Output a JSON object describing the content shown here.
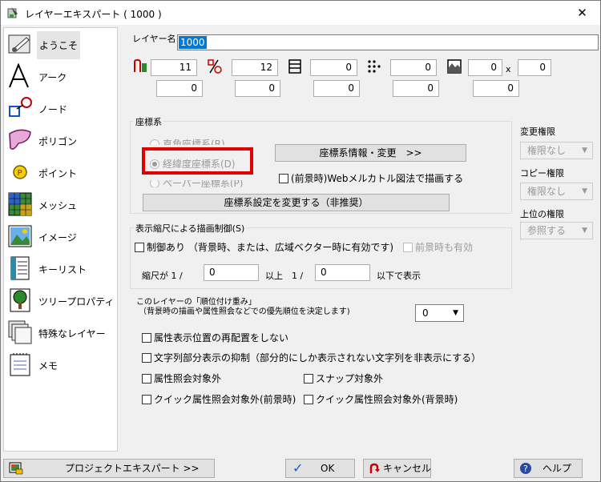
{
  "window": {
    "title": "レイヤーエキスパート ( 1000 )",
    "close": "✕"
  },
  "nav": [
    {
      "label": "ようこそ"
    },
    {
      "label": "アーク"
    },
    {
      "label": "ノード"
    },
    {
      "label": "ポリゴン"
    },
    {
      "label": "ポイント"
    },
    {
      "label": "メッシュ"
    },
    {
      "label": "イメージ"
    },
    {
      "label": "キーリスト"
    },
    {
      "label": "ツリープロパティ"
    },
    {
      "label": "特殊なレイヤー"
    },
    {
      "label": "メモ"
    }
  ],
  "layer_name": {
    "label": "レイヤー名",
    "value": "1000"
  },
  "counts": {
    "row1": [
      "11",
      "12",
      "0",
      "0",
      "0",
      "0"
    ],
    "x_label": "x",
    "row2": [
      "0",
      "0",
      "0",
      "0",
      "0"
    ]
  },
  "coord": {
    "group": "座標系",
    "radio1": "直角座標系(R)",
    "radio2": "経緯度座標系(D)",
    "radio3": "ペーパー座標系(P)",
    "info_button": "座標系情報・変更　>>",
    "mercator_check": "(前景時)Webメルカトル図法で描画する",
    "change_button": "座標系設定を変更する（非推奨）"
  },
  "scale": {
    "group": "表示縮尺による描画制御(S)",
    "control": "制御あり （背景時、または、広域ベクター時に有効です)",
    "foreground": "前景時も有効",
    "scale_label": "縮尺が 1 /",
    "min_value": "0",
    "above": "以上　1 /",
    "max_value": "0",
    "below": "以下で表示"
  },
  "priority": {
    "line1": "このレイヤーの「順位付け重み」",
    "line2": "（背景時の描画や属性照会などでの優先順位を決定します)",
    "value": "0"
  },
  "options": {
    "no_relocate": "属性表示位置の再配置をしない",
    "suppress_partial": "文字列部分表示の抑制（部分的にしか表示されない文字列を非表示にする）",
    "exclude_query": "属性照会対象外",
    "exclude_snap": "スナップ対象外",
    "quick_fg": "クイック属性照会対象外(前景時)",
    "quick_bg": "クイック属性照会対象外(背景時)"
  },
  "permissions": {
    "change_label": "変更権限",
    "change_value": "権限なし",
    "copy_label": "コピー権限",
    "copy_value": "権限なし",
    "upper_label": "上位の権限",
    "upper_value": "参照する"
  },
  "footer": {
    "project": "プロジェクトエキスパート >>",
    "ok": "OK",
    "cancel": "キャンセル",
    "help": "ヘルプ"
  },
  "colors": {
    "accent": "#0078d7",
    "highlight": "#e00000"
  }
}
